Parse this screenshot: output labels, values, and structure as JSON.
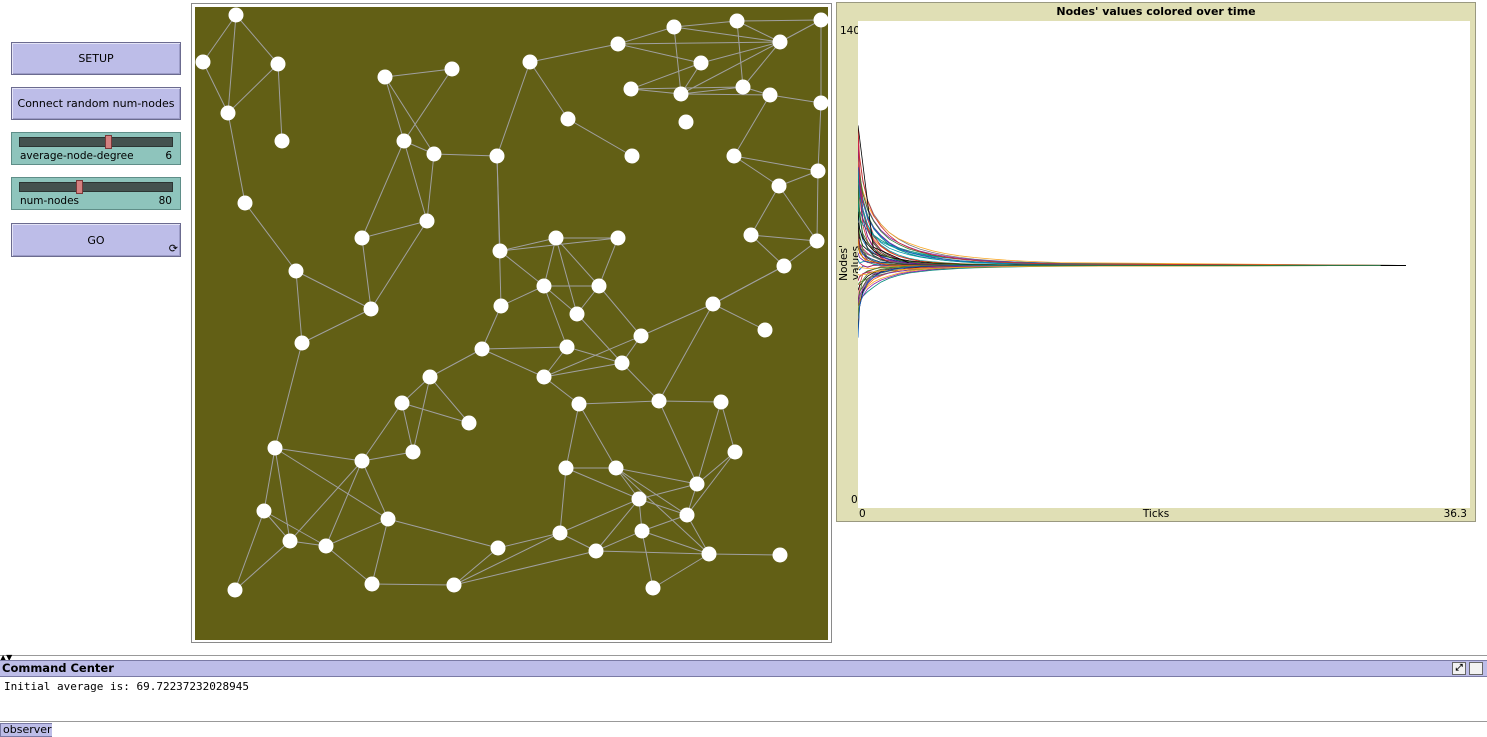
{
  "buttons": {
    "setup": "SETUP",
    "connect": "Connect random num-nodes",
    "go": "GO"
  },
  "forever_icon": "forever-arrows-icon",
  "sliders": [
    {
      "name": "average-node-degree",
      "value": "6",
      "fraction": 0.58
    },
    {
      "name": "num-nodes",
      "value": "80",
      "fraction": 0.38
    }
  ],
  "world": {
    "background": "#625f15",
    "node_color": "#ffffff",
    "link_color": "#a0a0a0",
    "node_count": 80
  },
  "plot": {
    "title": "Nodes' values colored over time",
    "xlabel": "Ticks",
    "ylabel": "Nodes' values",
    "xmin": "0",
    "xmax": "36.3",
    "ymin": "0",
    "ymax": "140"
  },
  "chart_data": {
    "type": "line",
    "title": "Nodes' values colored over time",
    "xlabel": "Ticks",
    "ylabel": "Nodes' values",
    "xlim": [
      0,
      36.3
    ],
    "ylim": [
      0,
      140
    ],
    "converged_value": 69.72,
    "last_tick": 32.5,
    "initial_range": [
      47,
      110
    ],
    "note_series": "one line per node; all series converge toward the average"
  },
  "command_center": {
    "title": "Command Center",
    "output": "Initial average is: 69.72237232028945",
    "prompt": "observer>"
  }
}
